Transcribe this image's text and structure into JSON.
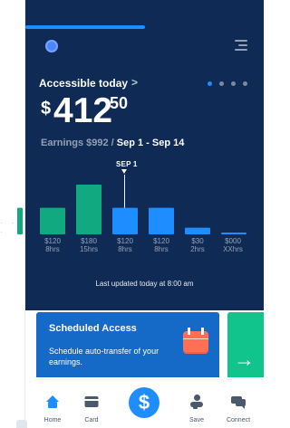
{
  "header": {
    "title": "Accessible today",
    "title_chevron": ">",
    "amount": {
      "currency": "$",
      "whole": "412",
      "cents": "50"
    },
    "earnings": {
      "prefix": "Earnings $992 /",
      "range": "Sep 1 - Sep 14"
    },
    "selected_day": "SEP 1",
    "updated": "Last updated today at 8:00 am",
    "progress_fraction": 0.5,
    "pager": {
      "count": 4,
      "active_index": 0
    }
  },
  "chart_data": {
    "type": "bar",
    "categories": [
      "",
      "$120",
      "$180",
      "$120",
      "$120",
      "$30",
      "$000"
    ],
    "series": [
      {
        "values": [
          8,
          8,
          15,
          8,
          8,
          2,
          0.5
        ]
      }
    ],
    "bottom_labels": [
      {
        "amount": "$120",
        "hours": "8hrs"
      },
      {
        "amount": "$180",
        "hours": "15hrs"
      },
      {
        "amount": "$120",
        "hours": "8hrs"
      },
      {
        "amount": "$120",
        "hours": "8hrs"
      },
      {
        "amount": "$30",
        "hours": "2hrs"
      },
      {
        "amount": "$000",
        "hours": "XXhrs"
      }
    ],
    "selected_category": "$120",
    "ylim": [
      0,
      15
    ],
    "colors": [
      "#11a97f",
      "#11a97f",
      "#11a97f",
      "#1e8dff",
      "#1e8dff",
      "#1e8dff",
      "#1e8dff"
    ]
  },
  "cards": {
    "scheduled": {
      "title": "Scheduled Access",
      "description": "Schedule auto-transfer of your earnings.",
      "icon": "calendar-icon"
    },
    "next": {
      "icon": "arrow-right-icon",
      "arrow": "→"
    }
  },
  "bottom_nav": {
    "items": [
      {
        "label": "Home",
        "icon": "home-icon"
      },
      {
        "label": "Card",
        "icon": "card-icon"
      },
      {
        "label": "Save",
        "icon": "save-icon"
      },
      {
        "label": "Connect",
        "icon": "connect-icon"
      }
    ],
    "center_button": {
      "symbol": "$",
      "icon": "dollar-icon"
    }
  },
  "colors": {
    "navy": "#0f2a55",
    "blue": "#1e8dff",
    "green": "#11a97f",
    "card_blue": "#1569c7",
    "card_green": "#11c48b"
  }
}
